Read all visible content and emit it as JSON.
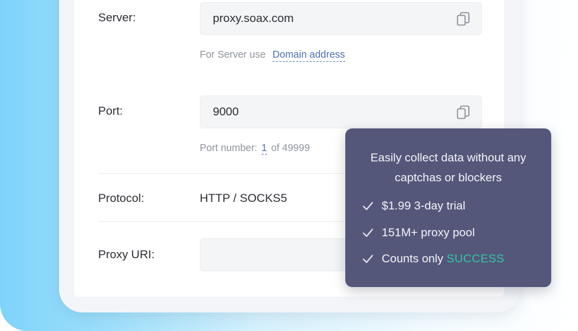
{
  "server": {
    "label": "Server:",
    "value": "proxy.soax.com",
    "hint_prefix": "For Server use",
    "hint_link": "Domain address"
  },
  "port": {
    "label": "Port:",
    "value": "9000",
    "hint_prefix": "Port number:",
    "hint_number": "1",
    "hint_suffix": "of 49999"
  },
  "protocol": {
    "label": "Protocol:",
    "value": "HTTP / SOCKS5"
  },
  "proxy_uri": {
    "label": "Proxy URI:",
    "value": ""
  },
  "tooltip": {
    "title": "Easily collect data without any captchas or blockers",
    "items": [
      {
        "text": "$1.99 3-day trial"
      },
      {
        "text": "151M+ proxy pool"
      },
      {
        "text": "Counts only ",
        "highlight": "SUCCESS"
      }
    ]
  },
  "icons": {
    "copy": "copy-icon",
    "check": "check-icon"
  },
  "colors": {
    "accent_link": "#4f6fb7",
    "tooltip_bg": "#55577a",
    "success": "#2fc7a4"
  }
}
